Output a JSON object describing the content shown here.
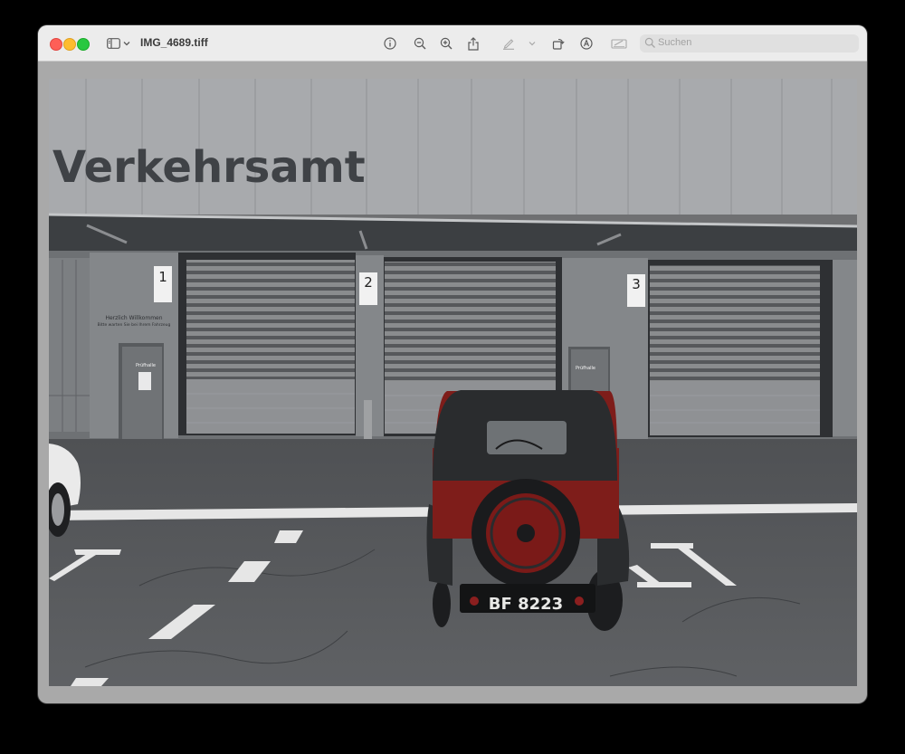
{
  "window": {
    "title": "IMG_4689.tiff",
    "search_placeholder": "Suchen"
  },
  "toolbar": {
    "icons": [
      "sidebar-icon",
      "chevron-down-icon",
      "info-icon",
      "zoom-out-icon",
      "zoom-in-icon",
      "share-icon",
      "highlight-pen-icon",
      "chevron-down-icon",
      "rotate-icon",
      "markup-icon",
      "signature-icon",
      "search-icon"
    ]
  },
  "photo": {
    "building_sign": "Verkehrsamt",
    "bay_numbers": [
      "1",
      "2",
      "3"
    ],
    "welcome_line1": "Herzlich Willkommen",
    "welcome_line2": "Bitte warten Sie bei Ihrem Fahrzeug",
    "door_sign_1": "Prüfhalle",
    "door_sign_2": "Prüfhalle",
    "license_plate": "BF 8223"
  },
  "colors": {
    "titlebar": "#ececec",
    "window_bg": "#a9a9a9",
    "car_body": "#7e1d1a",
    "car_roof": "#2a2c2e"
  }
}
